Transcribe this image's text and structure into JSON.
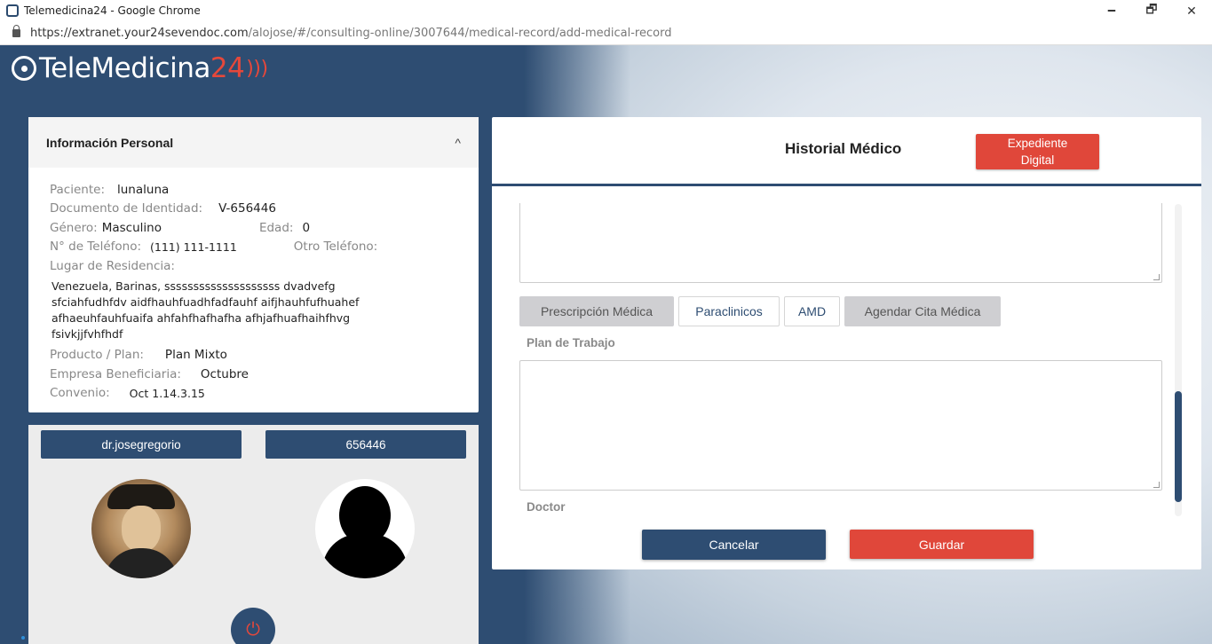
{
  "browser": {
    "window_title": "Telemedicina24 - Google Chrome",
    "url_host": "https://extranet.your24sevendoc.com",
    "url_path": "/alojose/#/consulting-online/3007644/medical-record/add-medical-record",
    "minimize": "🗕",
    "maximize": "🗗",
    "close": "✕"
  },
  "logo": {
    "text": "TeleMedicina",
    "num": "24",
    "waves": ")))"
  },
  "personal_info": {
    "title": "Información Personal",
    "chevron": "^",
    "paciente_label": "Paciente:",
    "paciente": "lunaluna",
    "doc_label": "Documento de Identidad:",
    "doc": "V-656446",
    "genero_label": "Género:",
    "genero": "Masculino",
    "edad_label": "Edad:",
    "edad": "0",
    "tel_label": "N° de Teléfono:",
    "tel": "(111) 111-1111",
    "otro_tel_label": "Otro Teléfono:",
    "residencia_label": "Lugar de Residencia:",
    "residencia_l1": "Venezuela, Barinas, ssssssssssssssssssss dvadvefg",
    "residencia_l2": "sfciahfudhfdv aidfhauhfuadhfadfauhf aifjhauhfufhuahef",
    "residencia_l3": "afhaeuhfauhfuaifa ahfahfhafhafha afhjafhuafhaihfhvg",
    "residencia_l4": "fsivkjjfvhfhdf",
    "producto_label": "Producto / Plan:",
    "producto": "Plan Mixto",
    "empresa_label": "Empresa Beneficiaria:",
    "empresa": "Octubre",
    "convenio_label": "Convenio:",
    "convenio": "Oct 1.14.3.15"
  },
  "video": {
    "doctor_name": "dr.josegregorio",
    "patient_id": "656446",
    "power_icon": "⏻"
  },
  "historial": {
    "title": "Historial Médico",
    "expediente_l1": "Expediente",
    "expediente_l2": "Digital",
    "tabs": [
      {
        "label": "Prescripción Médica"
      },
      {
        "label": "Paraclinicos"
      },
      {
        "label": "AMD"
      },
      {
        "label": "Agendar Cita Médica"
      }
    ],
    "plan_label": "Plan de Trabajo",
    "doctor_label": "Doctor",
    "cancel": "Cancelar",
    "save": "Guardar"
  }
}
